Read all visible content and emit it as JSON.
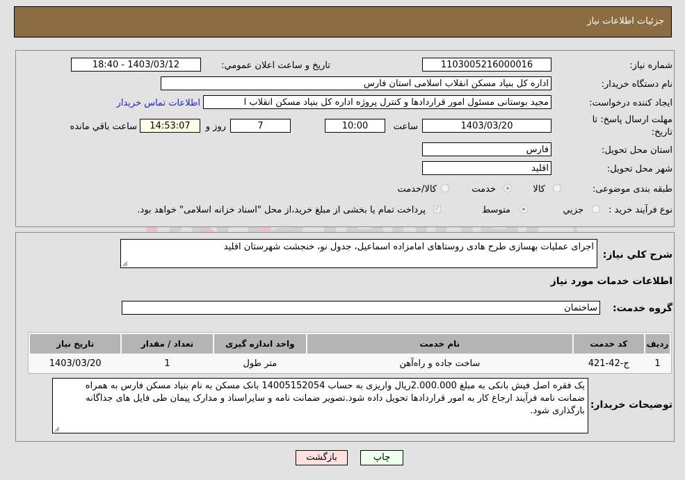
{
  "header": {
    "title": "جزئیات اطلاعات نیاز"
  },
  "form": {
    "need_number_label": "شماره نیاز:",
    "need_number": "1103005216000016",
    "announce_label": "تاريخ و ساعت اعلان عمومي:",
    "announce_value": "1403/03/12 - 18:40",
    "buyer_org_label": "نام دستگاه خريدار:",
    "buyer_org": "اداره کل بنیاد مسکن انقلاب اسلامی استان فارس",
    "creator_label": "ايجاد کننده درخواست:",
    "creator": "مجید بوستانی مسئول امور قراردادها و کنترل پروژه اداره کل بنیاد مسکن انقلاب ا",
    "contact_link": "اطلاعات تماس خريدار",
    "deadline_label": "مهلت ارسال پاسخ: تا تاريخ:",
    "deadline_date": "1403/03/20",
    "time_label": "ساعت",
    "deadline_time": "10:00",
    "days_value": "7",
    "days_label": "روز و",
    "remaining_time": "14:53:07",
    "remaining_label": "ساعت باقي مانده",
    "province_label": "استان محل تحويل:",
    "province": "فارس",
    "city_label": "شهر محل تحويل:",
    "city": "اقليد",
    "category_label": "طبقه بندی موضوعی:",
    "category_options": [
      {
        "label": "کالا",
        "checked": false
      },
      {
        "label": "خدمت",
        "checked": true
      },
      {
        "label": "کالا/خدمت",
        "checked": false
      }
    ],
    "process_label": "نوع فرآيند خريد :",
    "process_options": [
      {
        "label": "جزيي",
        "checked": false
      },
      {
        "label": "متوسط",
        "checked": true
      }
    ],
    "treasury_note": "پرداخت تمام يا بخشی از مبلغ خريد،از محل \"اسناد خزانه اسلامی\" خواهد بود.",
    "treasury_checked": true
  },
  "details": {
    "description_label": "شرح کلي نياز:",
    "description": "اجرای عملیات بهسازی طرح هادی روستاهای امامزاده اسماعیل، جدول نو، خنجشت شهرستان اقلید",
    "services_heading": "اطلاعات خدمات مورد نياز",
    "service_group_label": "گروه خدمت:",
    "service_group": "ساختمان",
    "table": {
      "headers": [
        "رديف",
        "کد خدمت",
        "نام خدمت",
        "واحد اندازه گيری",
        "تعداد / مقدار",
        "تاريخ نياز"
      ],
      "rows": [
        [
          "1",
          "ج-42-421",
          "ساخت جاده و راه‌آهن",
          "متر طول",
          "1",
          "1403/03/20"
        ]
      ]
    },
    "buyer_notes_label": "توضيحات خريدار:",
    "buyer_notes": "یک فقره اصل فیش بانکی به مبلغ 2.000.000ریال واریزی به حساب 14005152054 بانک مسکن به نام بنیاد مسکن فارس به همراه ضمانت نامه فرآیند ارجاع کار به امور قراردادها تحویل داده شود.تصویر ضمانت نامه و سایراسناد و مدارک پیمان طی فایل های جداگانه بارگذاری شود."
  },
  "buttons": {
    "print": "چاپ",
    "back": "بازگشت"
  },
  "watermark": {
    "text": "AriaTender.neT"
  },
  "colors": {
    "header": "#8c6c42",
    "link": "#2222cc",
    "print_bg": "#eeffee",
    "back_bg": "#ffe0e0"
  }
}
